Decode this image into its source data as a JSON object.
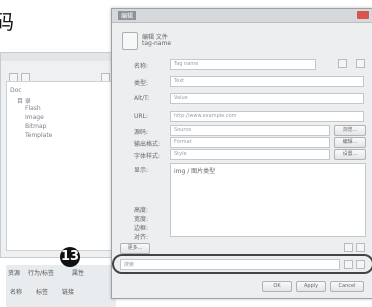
{
  "caption": "码",
  "step_number": "13",
  "back_window": {
    "tree": {
      "items": [
        {
          "label": "Doc"
        },
        {
          "label": "目 录"
        },
        {
          "label": "Flash"
        },
        {
          "label": "Image"
        },
        {
          "label": "Bitmap"
        },
        {
          "label": "Template"
        }
      ]
    },
    "tabs": [
      {
        "label": "资源"
      },
      {
        "label": "行为/标签"
      },
      {
        "label": "属性"
      }
    ],
    "status": [
      "名称",
      "标签",
      "链接"
    ]
  },
  "dialog": {
    "title": "编辑",
    "header_line1": "编辑 文件",
    "header_line2": "tag-name",
    "fields": [
      {
        "label": "名称:",
        "value": "Tag name"
      },
      {
        "label": "类型:",
        "value": "Text"
      },
      {
        "label": "Alt/T:",
        "value": "Value"
      },
      {
        "label": "URL:",
        "value": "http://www.example.com"
      },
      {
        "label": "源码:",
        "value": "Source"
      },
      {
        "label": "输出格式:",
        "value": "Format"
      },
      {
        "label": "字体样式:",
        "value": "Style"
      }
    ],
    "side_buttons": [
      "浏览...",
      "编辑...",
      "设置..."
    ],
    "text_label": "显示:",
    "text_value": "img / 图片类型",
    "small_labels": [
      "高度:",
      "宽度:",
      "边框:",
      "对齐:"
    ],
    "bottom_button": "更多...",
    "search_placeholder": "搜索",
    "footer_buttons": [
      "OK",
      "Apply",
      "Cancel"
    ]
  }
}
